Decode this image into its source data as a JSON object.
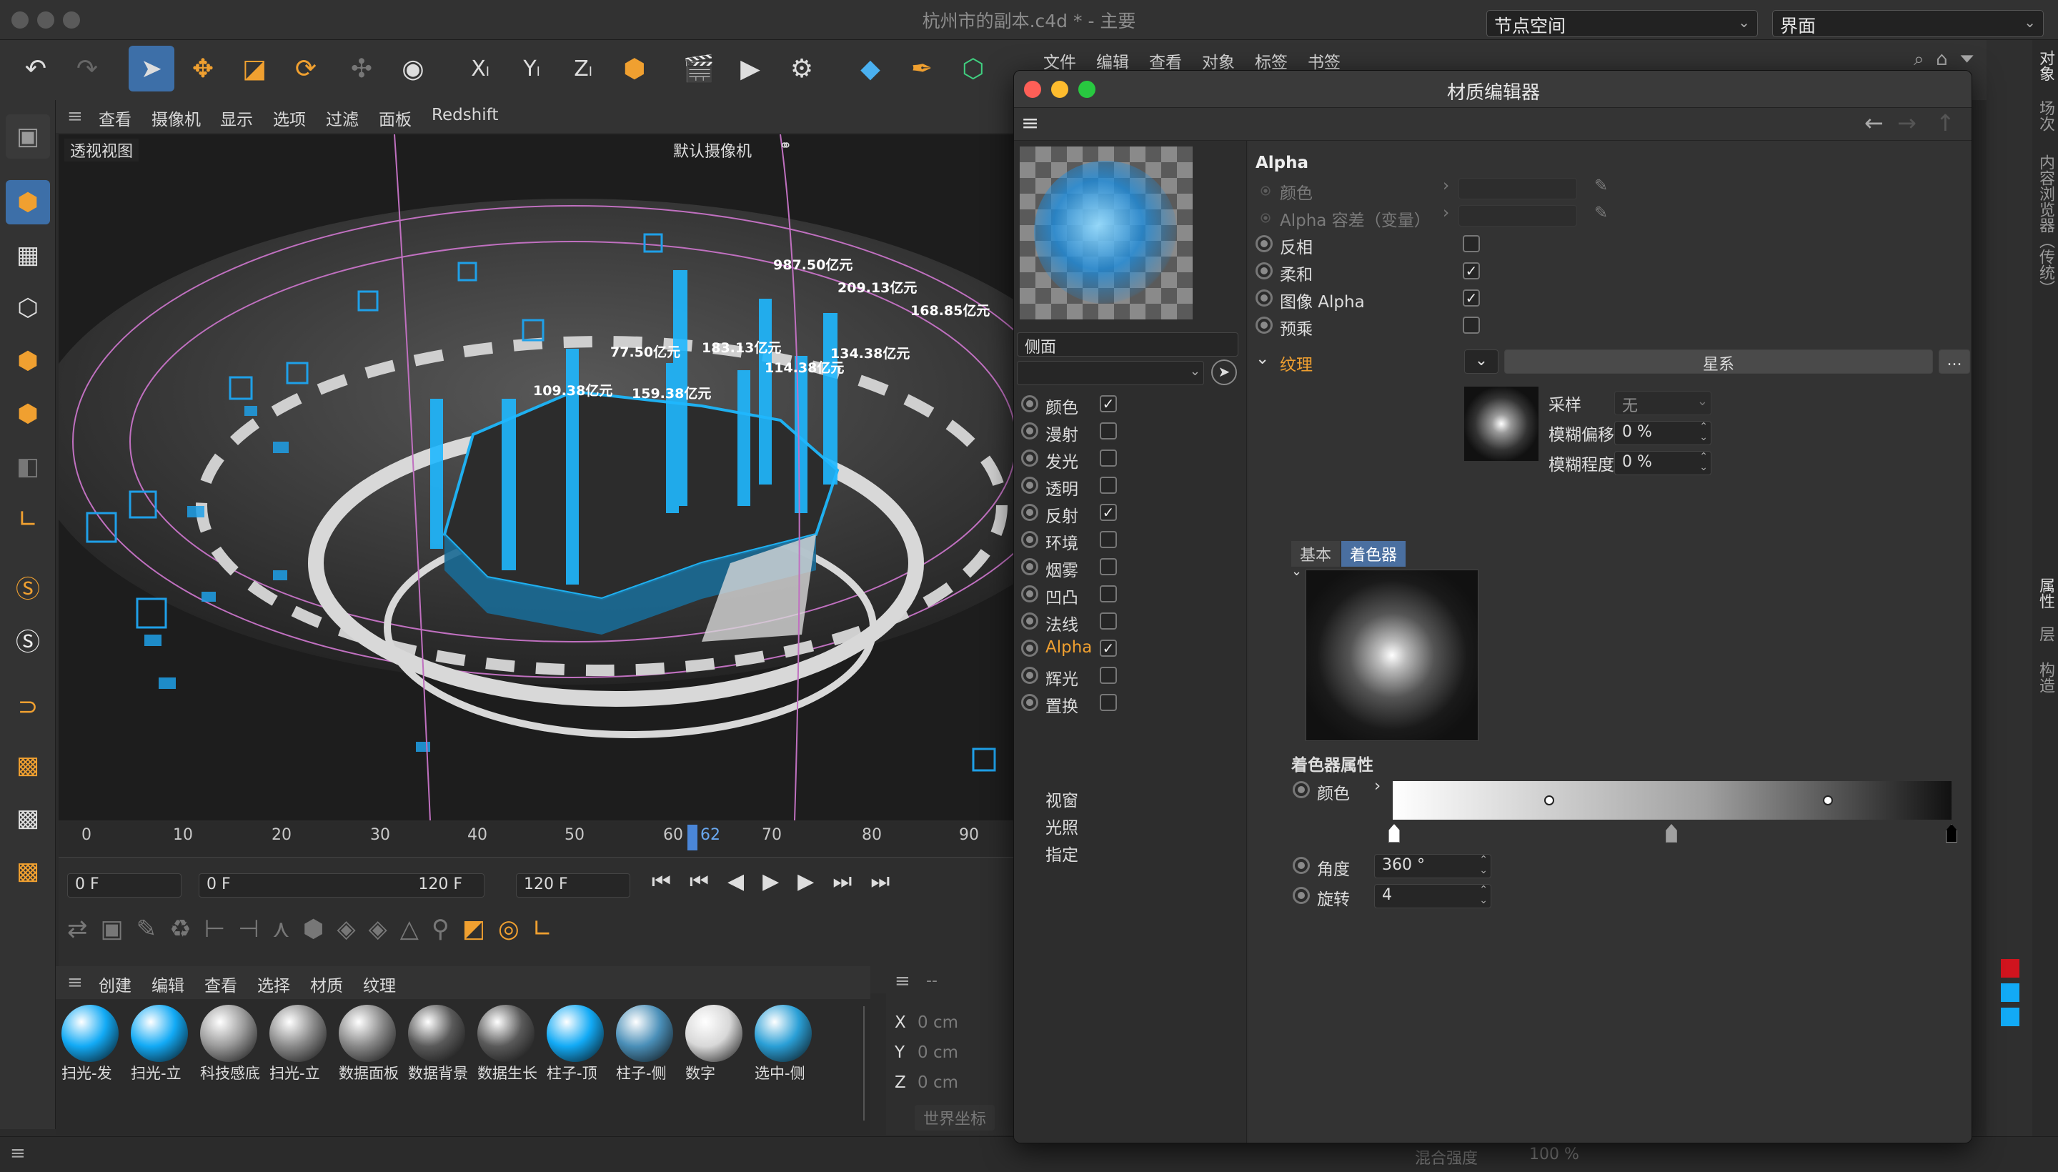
{
  "window": {
    "title": "杭州市的副本.c4d * - 主要",
    "node_space": "节点空间",
    "layout": "界面"
  },
  "top_menu": [
    "文件",
    "编辑",
    "查看",
    "对象",
    "标签",
    "书签"
  ],
  "viewport": {
    "menu": [
      "查看",
      "摄像机",
      "显示",
      "选项",
      "过滤",
      "面板",
      "Redshift"
    ],
    "name": "透视视图",
    "camera": "默认摄像机",
    "bar_labels": [
      "987.50亿元",
      "209.13亿元",
      "168.85亿元",
      "77.50亿元",
      "183.13亿元",
      "134.38亿元",
      "114.38亿元",
      "109.38亿元",
      "159.38亿元"
    ]
  },
  "timeline": {
    "ticks": [
      "0",
      "10",
      "20",
      "30",
      "40",
      "50",
      "60",
      "62",
      "70",
      "80",
      "90"
    ],
    "current_frame": "62",
    "start_field": "0 F",
    "range_start": "0 F",
    "range_end": "120 F",
    "end_field": "120 F"
  },
  "material_manager": {
    "menu": [
      "创建",
      "编辑",
      "查看",
      "选择",
      "材质",
      "纹理"
    ],
    "materials": [
      {
        "label": "扫光-发",
        "color": "#12aaf5"
      },
      {
        "label": "扫光-立",
        "color": "#12aaf5"
      },
      {
        "label": "科技感底",
        "color": "#9a9a9a"
      },
      {
        "label": "扫光-立",
        "color": "#8a8a8a"
      },
      {
        "label": "数据面板",
        "color": "#888888"
      },
      {
        "label": "数据背景",
        "color": "#5a5a5a"
      },
      {
        "label": "数据生长",
        "color": "#5a5a5a"
      },
      {
        "label": "柱子-顶",
        "color": "#12aaf5"
      },
      {
        "label": "柱子-侧",
        "color": "#4a8fb8"
      },
      {
        "label": "数字",
        "color": "#d8d8d8"
      },
      {
        "label": "选中-侧",
        "color": "#2a9fd6"
      }
    ]
  },
  "coordinates": {
    "header": "--",
    "rows": [
      {
        "axis": "X",
        "value": "0 cm"
      },
      {
        "axis": "Y",
        "value": "0 cm"
      },
      {
        "axis": "Z",
        "value": "0 cm"
      }
    ],
    "world": "世界坐标"
  },
  "status": {
    "blend": "混合强度",
    "blend_value": "100 %"
  },
  "right_tabs": [
    "对象",
    "场次",
    "内容浏览器（传统）",
    "属性",
    "层",
    "构造"
  ],
  "material_editor": {
    "title": "材质编辑器",
    "material_name": "侧面",
    "channels": [
      {
        "label": "颜色",
        "checked": true
      },
      {
        "label": "漫射",
        "checked": false
      },
      {
        "label": "发光",
        "checked": false
      },
      {
        "label": "透明",
        "checked": false
      },
      {
        "label": "反射",
        "checked": true
      },
      {
        "label": "环境",
        "checked": false
      },
      {
        "label": "烟雾",
        "checked": false
      },
      {
        "label": "凹凸",
        "checked": false
      },
      {
        "label": "法线",
        "checked": false
      },
      {
        "label": "Alpha",
        "checked": true,
        "active": true
      },
      {
        "label": "辉光",
        "checked": false
      },
      {
        "label": "置换",
        "checked": false
      }
    ],
    "extra": [
      "视窗",
      "光照",
      "指定"
    ],
    "alpha": {
      "heading": "Alpha",
      "color_label": "颜色",
      "tolerance_label": "Alpha 容差（变量）",
      "invert": {
        "label": "反相",
        "checked": false
      },
      "soft": {
        "label": "柔和",
        "checked": true
      },
      "image_alpha": {
        "label": "图像 Alpha",
        "checked": true
      },
      "premultiply": {
        "label": "预乘",
        "checked": false
      },
      "texture_label": "纹理",
      "texture_name": "星系",
      "more": "...",
      "sampling_label": "采样",
      "sampling_value": "无",
      "blur_offset_label": "模糊偏移",
      "blur_offset_value": "0 %",
      "blur_scale_label": "模糊程度",
      "blur_scale_value": "0 %",
      "tabs": [
        "基本",
        "着色器"
      ],
      "active_tab": "着色器",
      "shader_props": "着色器属性",
      "shader_color_label": "颜色",
      "angle_label": "角度",
      "angle_value": "360 °",
      "rotate_label": "旋转",
      "rotate_value": "4"
    }
  }
}
